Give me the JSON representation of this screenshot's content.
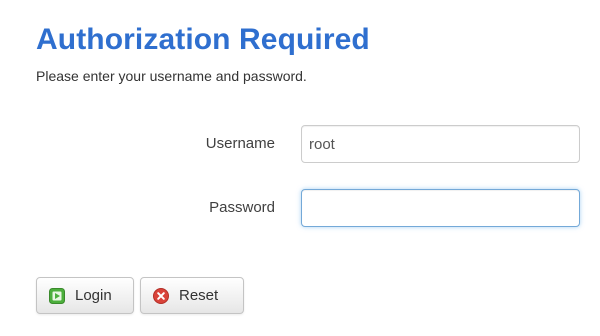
{
  "header": {
    "title": "Authorization Required",
    "description": "Please enter your username and password."
  },
  "form": {
    "username": {
      "label": "Username",
      "value": "root"
    },
    "password": {
      "label": "Password",
      "value": ""
    }
  },
  "actions": {
    "login_label": "Login",
    "login_icon": "login-icon",
    "reset_label": "Reset",
    "reset_icon": "reset-icon"
  },
  "colors": {
    "title": "#2f6fcf",
    "focus_border": "#74a9d8",
    "login_icon": "#4caf3c",
    "reset_icon": "#d9433a"
  }
}
